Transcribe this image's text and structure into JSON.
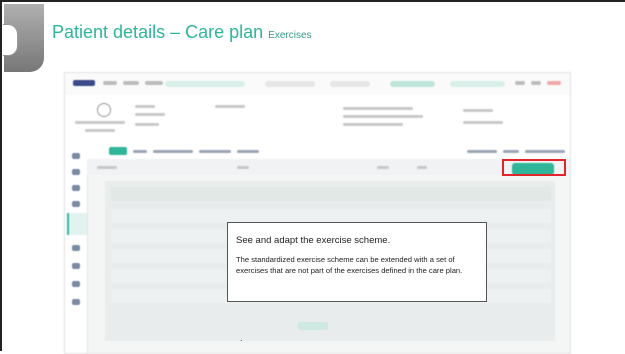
{
  "slide": {
    "title": "Patient details – Care plan",
    "subtitle": "Exercises"
  },
  "callout": {
    "heading": "See and adapt the exercise scheme.",
    "body": "The standardized exercise scheme can be extended with a set of exercises that are not part of the exercises defined in the care plan."
  },
  "footer_mark": ".",
  "colors": {
    "title_teal": "#2fb59a",
    "highlight_red": "#e0262a",
    "nav_active": "#2fb59a"
  },
  "icons": {
    "avatar": "avatar-icon",
    "nav": "nav-item-icon"
  }
}
